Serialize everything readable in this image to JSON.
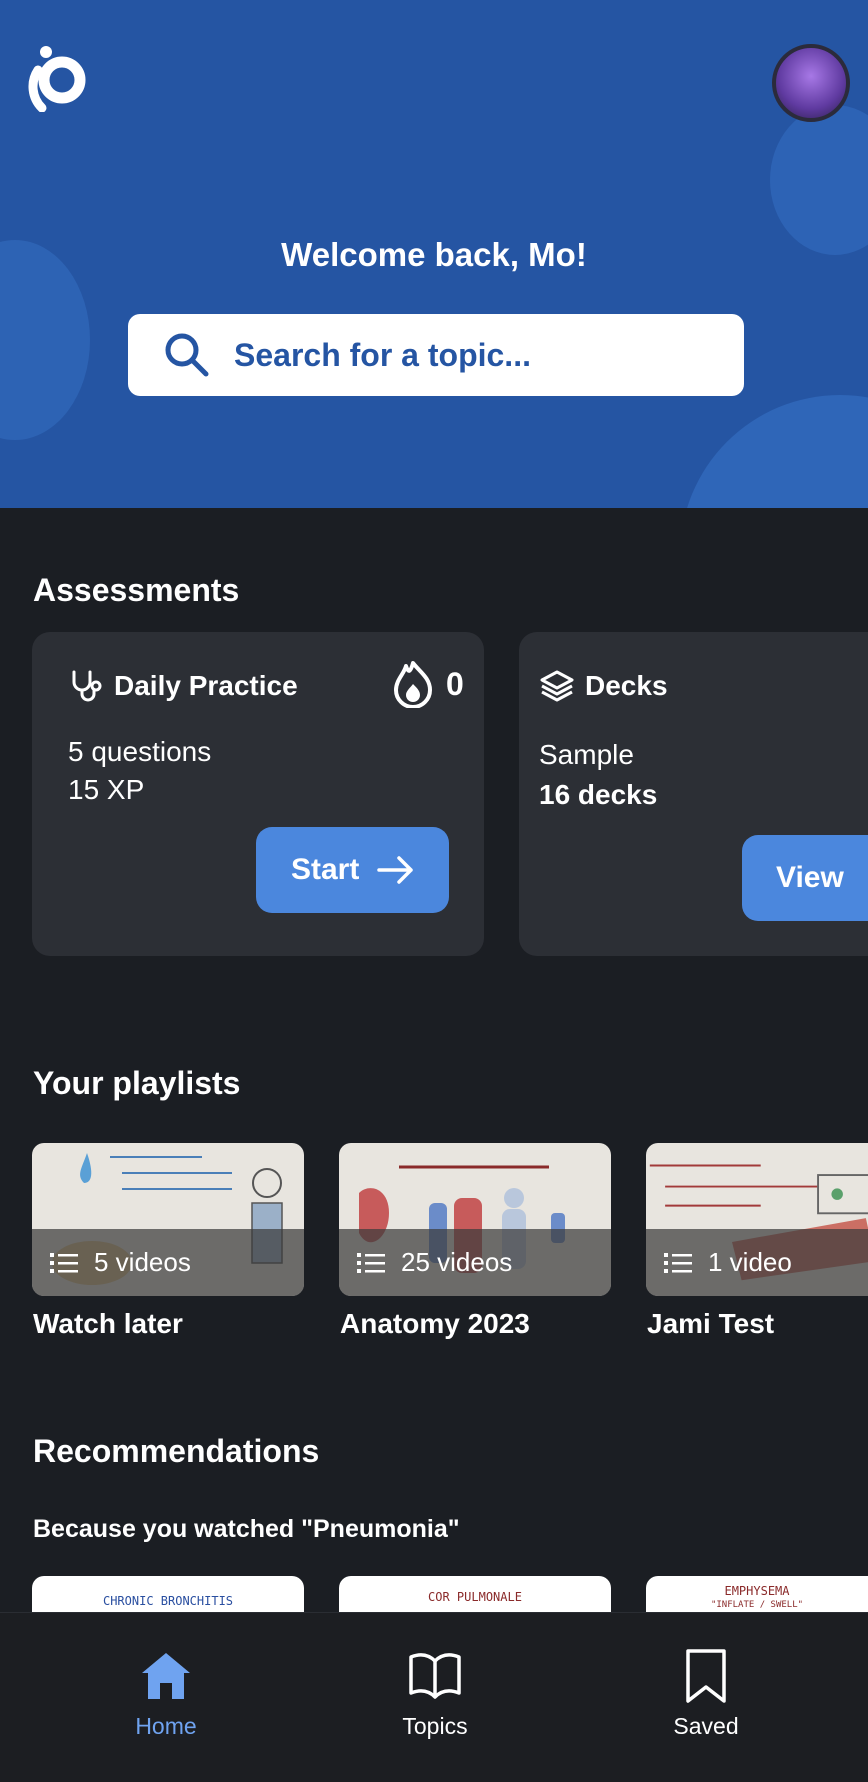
{
  "header": {
    "welcome": "Welcome back, Mo!",
    "search_placeholder": "Search for a topic..."
  },
  "assessments": {
    "title": "Assessments",
    "daily_practice": {
      "label": "Daily Practice",
      "streak": "0",
      "questions": "5 questions",
      "xp": "15 XP",
      "button": "Start"
    },
    "decks": {
      "label": "Decks",
      "sample": "Sample",
      "count": "16 decks",
      "button": "View"
    }
  },
  "playlists": {
    "title": "Your playlists",
    "items": [
      {
        "name": "Watch later",
        "count": "5 videos"
      },
      {
        "name": "Anatomy 2023",
        "count": "25 videos"
      },
      {
        "name": "Jami Test",
        "count": "1 video"
      }
    ]
  },
  "recommendations": {
    "title": "Recommendations",
    "subtitle": "Because you watched \"Pneumonia\"",
    "items": [
      {
        "label": "CHRONIC BRONCHITIS"
      },
      {
        "label": "COR PULMONALE"
      },
      {
        "label": "EMPHYSEMA",
        "sub": "\"INFLATE / SWELL\""
      }
    ]
  },
  "nav": {
    "home": "Home",
    "topics": "Topics",
    "saved": "Saved"
  },
  "colors": {
    "hero": "#2555a3",
    "accent": "#4b87dd",
    "active_nav": "#6fa3f0",
    "background": "#1b1e23",
    "card": "#2c2f35"
  }
}
